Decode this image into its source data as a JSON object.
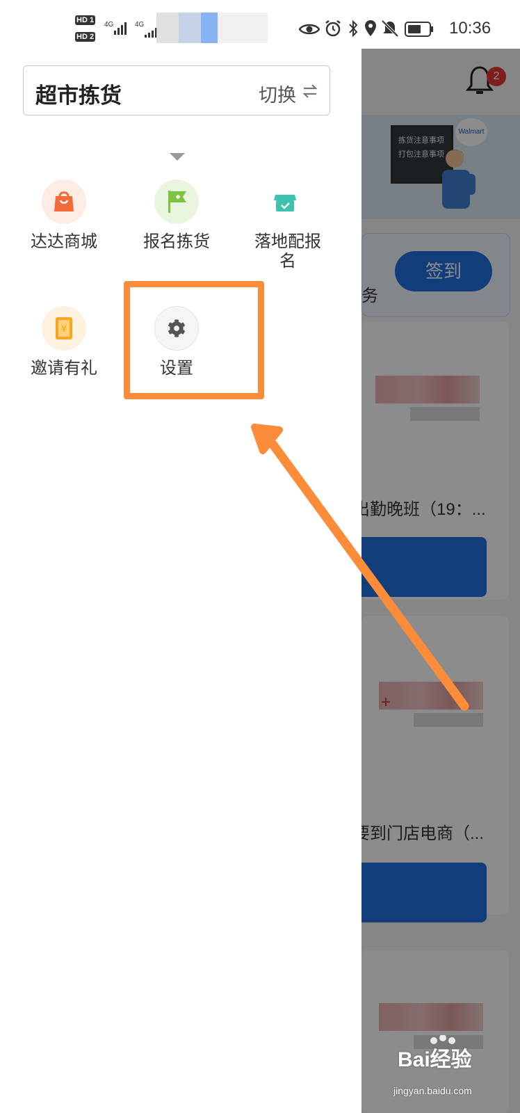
{
  "status_bar": {
    "time": "10:36",
    "sim1": "HD 1",
    "sim2": "HD 2",
    "net1": "4G",
    "net2": "4G",
    "icons": [
      "eye-icon",
      "alarm-icon",
      "bluetooth-icon",
      "location-icon",
      "mute-icon",
      "battery-icon"
    ]
  },
  "drawer": {
    "selector": {
      "title": "超市拣货",
      "switch_label": "切换"
    },
    "menu": [
      {
        "label": "达达商城",
        "icon": "shopping-bag-icon",
        "color": "#f26b3a"
      },
      {
        "label": "报名拣货",
        "icon": "flag-icon",
        "color": "#7cc243"
      },
      {
        "label": "落地配报名",
        "icon": "store-icon",
        "color": "#3fc1b0"
      },
      {
        "label": "邀请有礼",
        "icon": "coupon-icon",
        "color": "#f6a623"
      },
      {
        "label": "设置",
        "icon": "gear-icon",
        "color": "#555555"
      }
    ]
  },
  "background": {
    "notification_count": "2",
    "banner_lines": [
      "拣货注意事项",
      "打包注意事项"
    ],
    "brand": "Walmart",
    "signin_label": "签到",
    "task_fragment": "务",
    "shift_1": "出勤晚班（19：...",
    "shift_2": "要到门店电商（...",
    "red_mark": "+"
  },
  "annotation": {
    "highlight_color": "#fb8c3a"
  },
  "watermark": {
    "text": "Bai经验",
    "url": "jingyan.baidu.com"
  }
}
